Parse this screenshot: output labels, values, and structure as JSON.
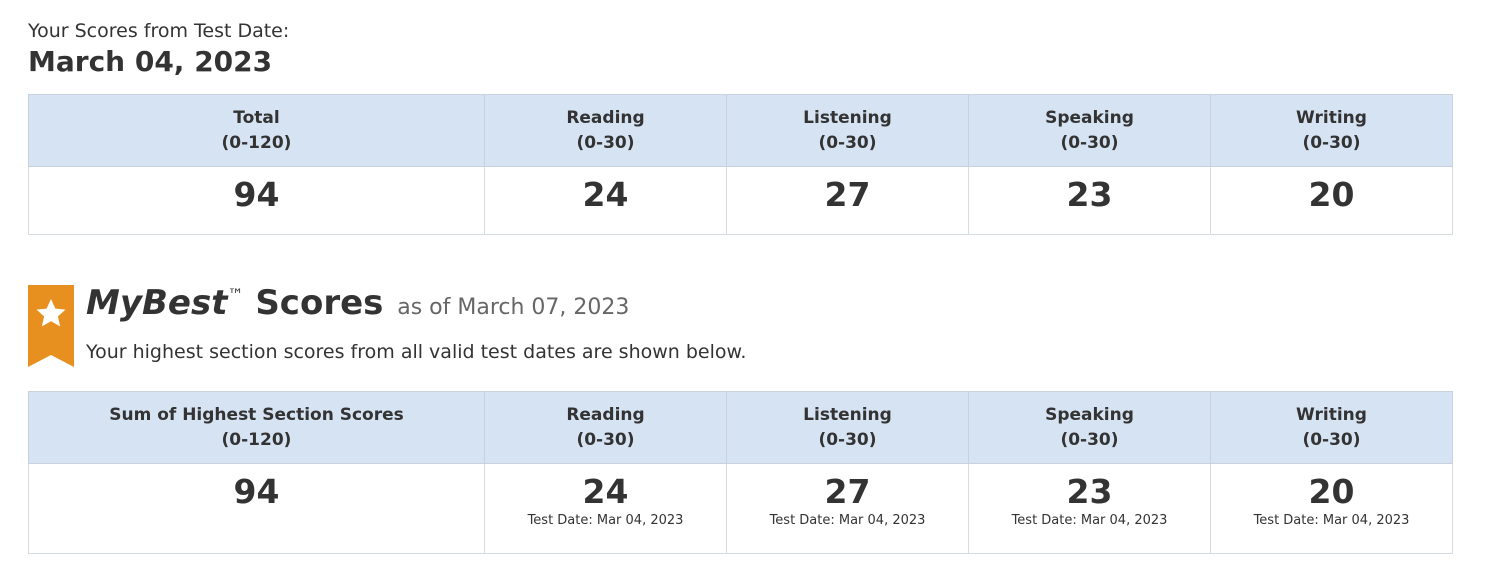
{
  "header": {
    "intro": "Your Scores from Test Date:",
    "test_date": "March 04, 2023"
  },
  "scores_table": {
    "columns": [
      {
        "name": "Total",
        "range": "(0-120)",
        "score": "94"
      },
      {
        "name": "Reading",
        "range": "(0-30)",
        "score": "24"
      },
      {
        "name": "Listening",
        "range": "(0-30)",
        "score": "27"
      },
      {
        "name": "Speaking",
        "range": "(0-30)",
        "score": "23"
      },
      {
        "name": "Writing",
        "range": "(0-30)",
        "score": "20"
      }
    ]
  },
  "mybest": {
    "brand": "MyBest",
    "trademark": "™",
    "title_word": "Scores",
    "as_of": "as of March 07, 2023",
    "subtitle": "Your highest section scores from all valid test dates are shown below.",
    "icon": "star-ribbon-icon",
    "ribbon_color": "#e8901f"
  },
  "best_table": {
    "columns": [
      {
        "name": "Sum of Highest Section Scores",
        "range": "(0-120)",
        "score": "94",
        "test_date": ""
      },
      {
        "name": "Reading",
        "range": "(0-30)",
        "score": "24",
        "test_date": "Test Date: Mar 04, 2023"
      },
      {
        "name": "Listening",
        "range": "(0-30)",
        "score": "27",
        "test_date": "Test Date: Mar 04, 2023"
      },
      {
        "name": "Speaking",
        "range": "(0-30)",
        "score": "23",
        "test_date": "Test Date: Mar 04, 2023"
      },
      {
        "name": "Writing",
        "range": "(0-30)",
        "score": "20",
        "test_date": "Test Date: Mar 04, 2023"
      }
    ]
  },
  "colors": {
    "header_bg": "#d6e3f3",
    "text": "#333333",
    "muted": "#666666"
  }
}
